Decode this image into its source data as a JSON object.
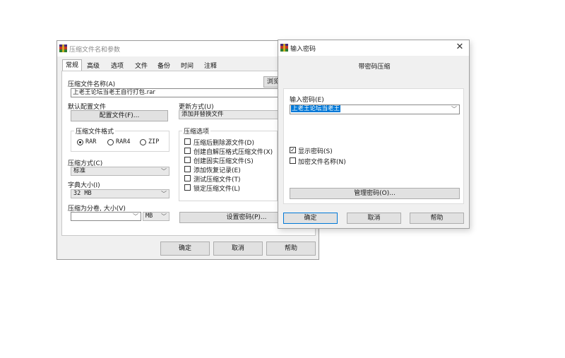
{
  "main_window": {
    "title": "压缩文件名和参数",
    "tabs": [
      "常规",
      "高级",
      "选项",
      "文件",
      "备份",
      "时间",
      "注释"
    ],
    "archive_name_label": "压缩文件名称(A)",
    "browse_label": "浏览",
    "archive_name_value": "上老王论坛当老王自行打包.rar",
    "profile_label": "默认配置文件",
    "profile_button": "配置文件(F)...",
    "update_mode_label": "更新方式(U)",
    "update_mode_value": "添加并替换文件",
    "format_group_label": "压缩文件格式",
    "format_rar": "RAR",
    "format_rar4": "RAR4",
    "format_zip": "ZIP",
    "method_label": "压缩方式(C)",
    "method_value": "标准",
    "dict_label": "字典大小(I)",
    "dict_value": "32 MB",
    "split_label": "压缩为分卷, 大小(V)",
    "split_value": "",
    "split_unit": "MB",
    "options_group_label": "压缩选项",
    "options": [
      {
        "label": "压缩后删除源文件(D)",
        "checked": false
      },
      {
        "label": "创建自解压格式压缩文件(X)",
        "checked": false
      },
      {
        "label": "创建固实压缩文件(S)",
        "checked": false
      },
      {
        "label": "添加恢复记录(E)",
        "checked": false
      },
      {
        "label": "测试压缩文件(T)",
        "checked": false
      },
      {
        "label": "锁定压缩文件(L)",
        "checked": false
      }
    ],
    "set_password_button": "设置密码(P)...",
    "ok_button": "确定",
    "cancel_button": "取消",
    "help_button": "帮助"
  },
  "password_dialog": {
    "title": "输入密码",
    "close_glyph": "✕",
    "heading": "带密码压缩",
    "enter_password_label": "输入密码(E)",
    "password_value": "上老王论坛当老王",
    "show_password_label": "显示密码(S)",
    "show_password_checked": true,
    "encrypt_names_label": "加密文件名称(N)",
    "encrypt_names_checked": false,
    "manage_button": "管理密码(O)...",
    "ok_button": "确定",
    "cancel_button": "取消",
    "help_button": "帮助"
  },
  "icons": {
    "app_icon": "winrar-books-icon",
    "dropdown": "chevron-down-icon",
    "check_glyph": "✓"
  },
  "colors": {
    "selection": "#0078d7",
    "window_bg": "#f0f0f0"
  }
}
